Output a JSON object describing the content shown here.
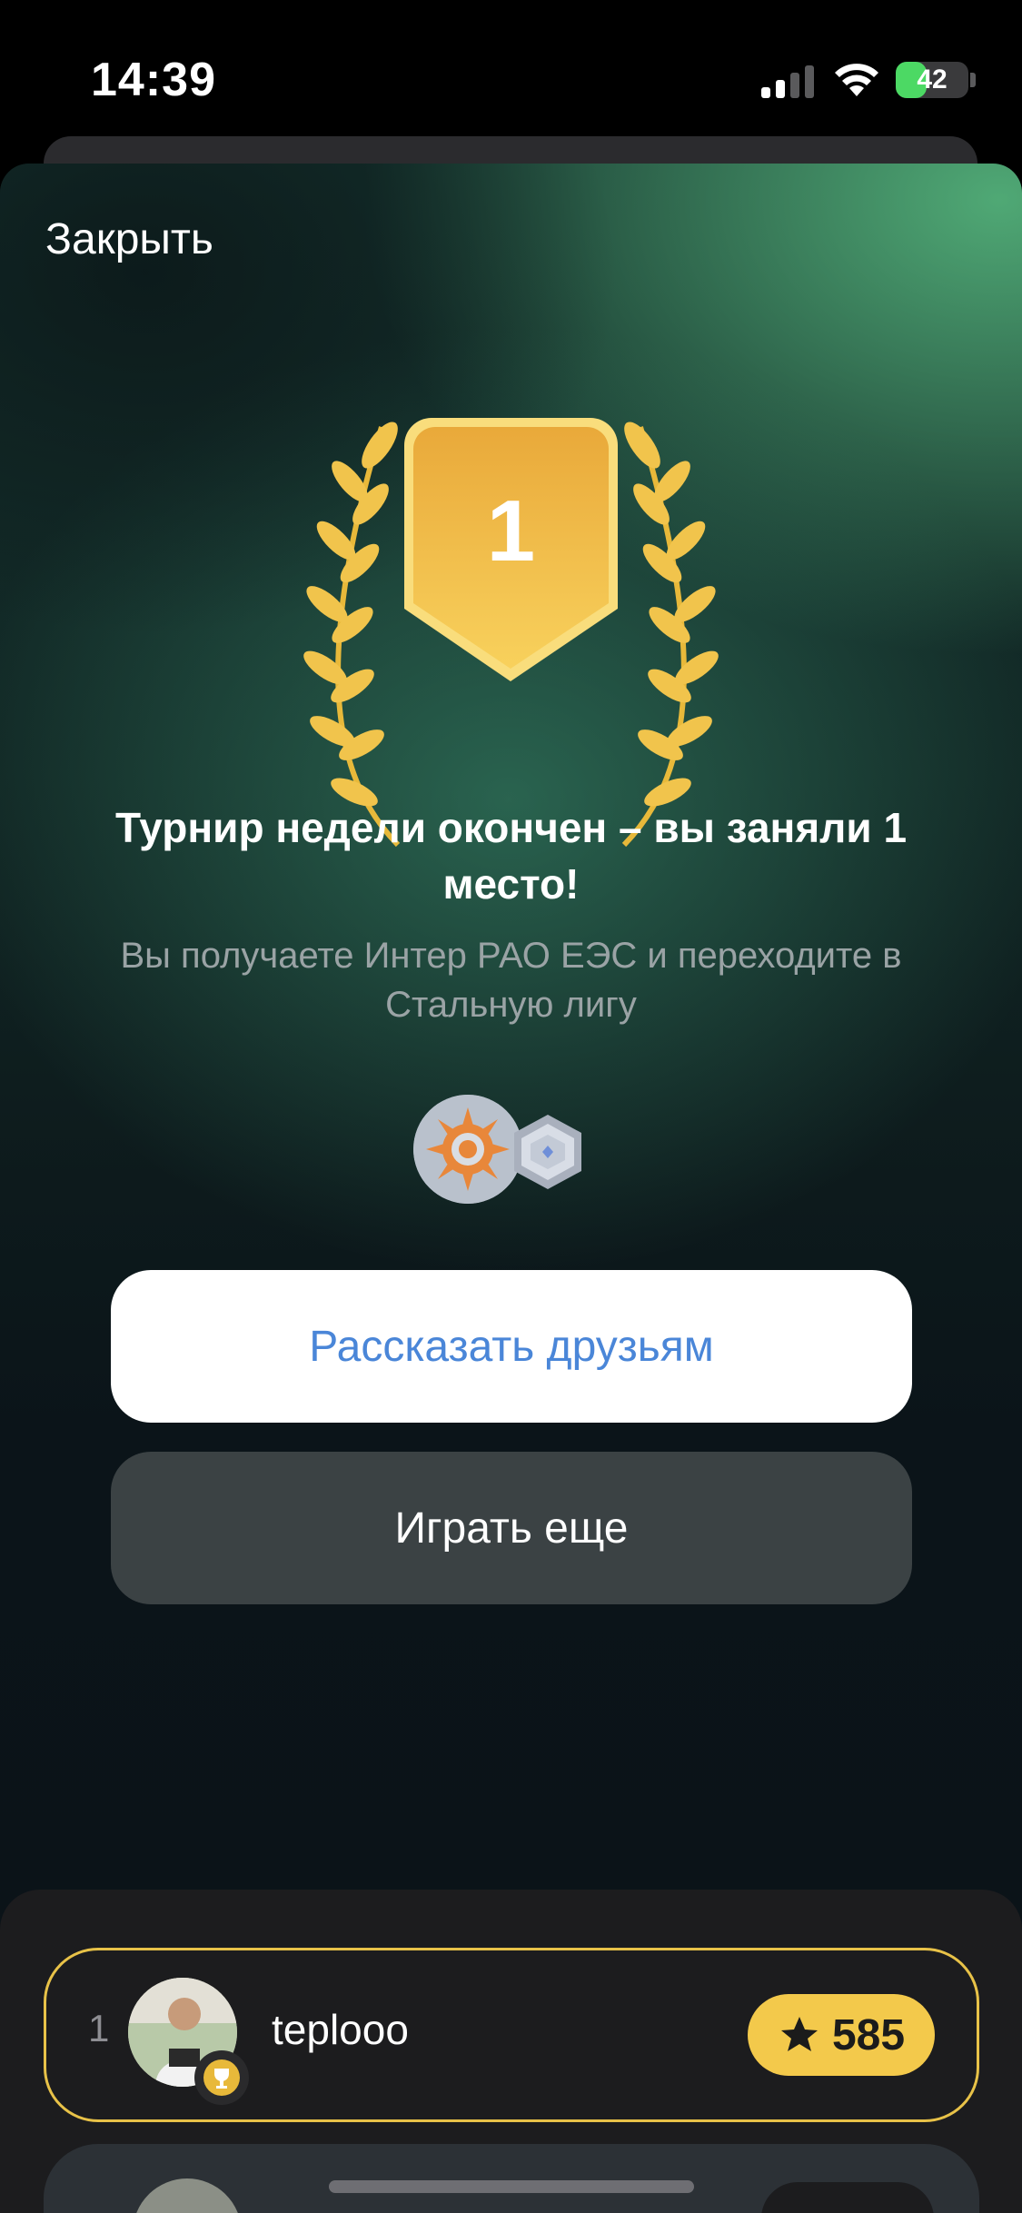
{
  "status_bar": {
    "time": "14:39",
    "battery": "42",
    "battery_level": 0.42,
    "battery_color": "#4cd964"
  },
  "modal": {
    "close_label": "Закрыть",
    "rank": "1",
    "headline": "Турнир недели окончен – вы заняли 1 место!",
    "subline": "Вы получаете Интер РАО ЕЭС и переходите в Стальную лигу",
    "rewards": [
      {
        "icon": "inter-rao-logo-icon"
      },
      {
        "icon": "steel-league-badge-icon"
      }
    ],
    "share_button": "Рассказать друзьям",
    "play_button": "Играть еще",
    "accent_color": "#f3c94b",
    "link_color": "#4a86d8"
  },
  "leaderboard": {
    "rows": [
      {
        "position": "1",
        "name": "teplooo",
        "score": "585",
        "icon": "star-icon",
        "highlight": true
      }
    ]
  }
}
